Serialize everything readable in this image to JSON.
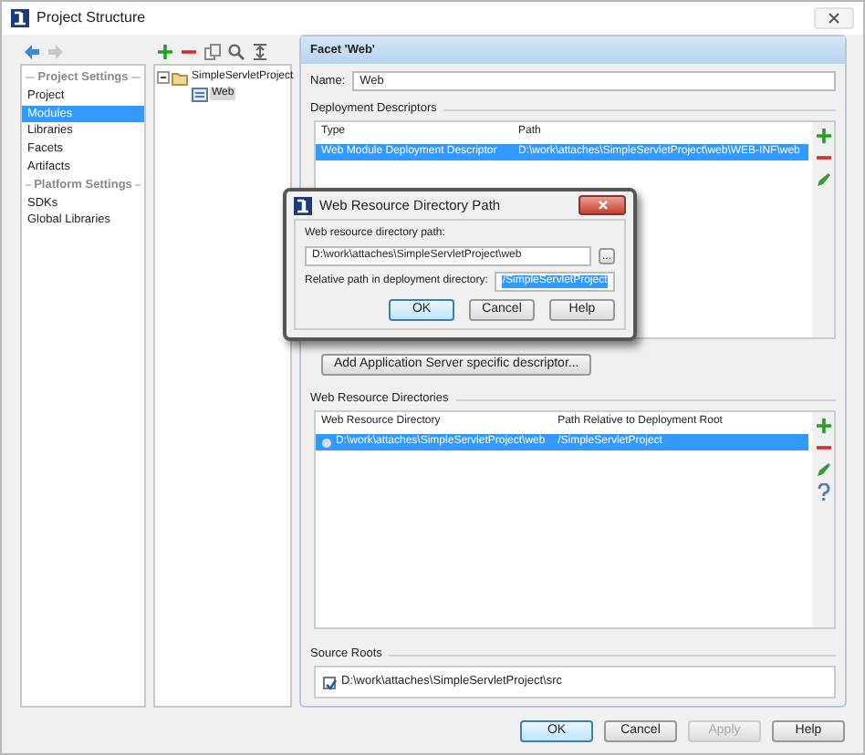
{
  "window": {
    "title": "Project Structure"
  },
  "sidebar": {
    "items": [
      {
        "kind": "header",
        "label": "Project Settings"
      },
      {
        "kind": "item",
        "label": "Project",
        "selected": false
      },
      {
        "kind": "item",
        "label": "Modules",
        "selected": true
      },
      {
        "kind": "item",
        "label": "Libraries",
        "selected": false
      },
      {
        "kind": "item",
        "label": "Facets",
        "selected": false
      },
      {
        "kind": "item",
        "label": "Artifacts",
        "selected": false
      },
      {
        "kind": "header",
        "label": "Platform Settings"
      },
      {
        "kind": "item",
        "label": "SDKs",
        "selected": false
      },
      {
        "kind": "item",
        "label": "Global Libraries",
        "selected": false
      }
    ]
  },
  "tree": {
    "nodes": [
      {
        "label": "SimpleServletProject",
        "kind": "project",
        "expanded": true,
        "selected": false,
        "children": [
          {
            "label": "Web",
            "kind": "facet",
            "selected": true
          }
        ]
      }
    ]
  },
  "facet": {
    "title": "Facet 'Web'",
    "name_label": "Name:",
    "name_value": "Web",
    "deployment": {
      "title": "Deployment Descriptors",
      "columns": [
        "Type",
        "Path"
      ],
      "rows": [
        {
          "cells": [
            "Web Module Deployment Descriptor",
            "D:\\work\\attaches\\SimpleServletProject\\web\\WEB-INF\\web"
          ],
          "selected": true
        }
      ]
    },
    "add_button": "Add Application Server specific descriptor...",
    "web_dirs": {
      "title": "Web Resource Directories",
      "columns": [
        "Web Resource Directory",
        "Path Relative to Deployment Root"
      ],
      "rows": [
        {
          "cells": [
            "D:\\work\\attaches\\SimpleServletProject\\web",
            "/SimpleServletProject"
          ],
          "selected": true
        }
      ]
    },
    "source_roots": {
      "title": "Source Roots",
      "items": [
        {
          "label": "D:\\work\\attaches\\SimpleServletProject\\src",
          "checked": true
        }
      ]
    }
  },
  "buttons": [
    {
      "label": "OK",
      "default": true,
      "disabled": false
    },
    {
      "label": "Cancel",
      "default": false,
      "disabled": false
    },
    {
      "label": "Apply",
      "default": false,
      "disabled": true
    },
    {
      "label": "Help",
      "default": false,
      "disabled": false
    }
  ],
  "dialog": {
    "title": "Web Resource Directory Path",
    "path_label": "Web resource directory path:",
    "path_value": "D:\\work\\attaches\\SimpleServletProject\\web",
    "browse_label": "...",
    "relative_label": "Relative path in deployment directory:",
    "relative_value": "/SimpleServletProject",
    "relative_text_selected": true,
    "buttons": [
      {
        "label": "OK",
        "default": true
      },
      {
        "label": "Cancel",
        "default": false
      },
      {
        "label": "Help",
        "default": false
      }
    ]
  }
}
